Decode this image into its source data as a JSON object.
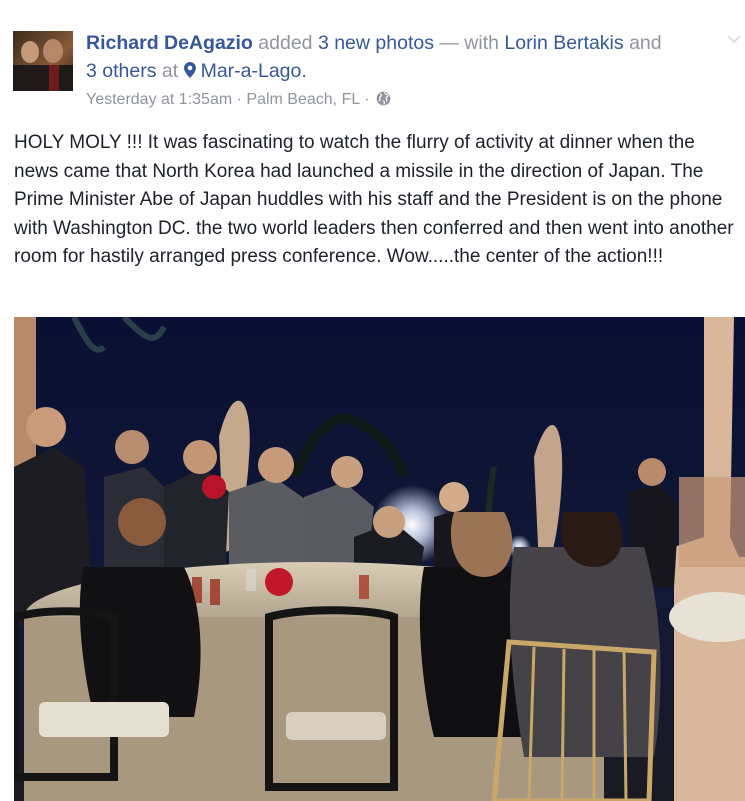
{
  "post": {
    "author": "Richard DeAgazio",
    "action_text": "added",
    "photos_count_text": "3 new photos",
    "with_text": "— with",
    "tagged_person": "Lorin Bertakis",
    "and_text": "and",
    "others_text": "3 others",
    "at_text": "at",
    "location": "Mar-a-Lago.",
    "timestamp": "Yesterday at 1:35am",
    "separator": "·",
    "place": "Palm Beach, FL",
    "privacy_icon": "globe-icon",
    "body": "HOLY MOLY !!! It was fascinating to watch the flurry of activity at dinner when the news came that North Korea had launched a missile in the direction of Japan. The Prime Minister Abe of Japan huddles with his staff and the President is on the phone with Washington DC. the two world leaders then conferred and then went into another room for hastily arranged press conference. Wow.....the center of the action!!!"
  },
  "colors": {
    "link": "#365899",
    "muted": "#90949c",
    "text": "#1d2129"
  }
}
